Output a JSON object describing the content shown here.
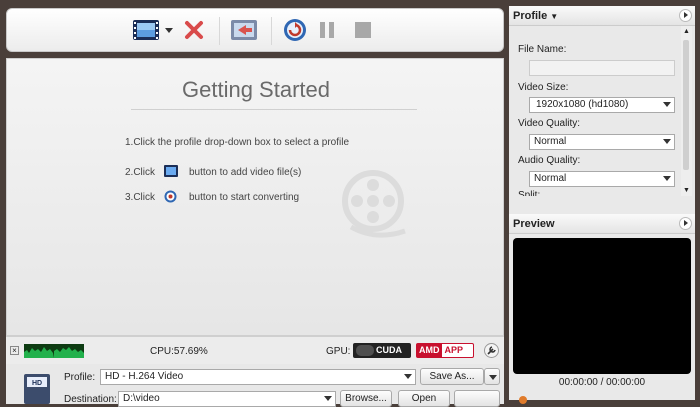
{
  "toolbar": {
    "buttons": [
      {
        "name": "add-video-button",
        "icon": "film-strip-icon"
      },
      {
        "name": "add-dropdown-button",
        "icon": "chevron-down-icon"
      },
      {
        "name": "remove-button",
        "icon": "red-x-icon"
      },
      {
        "name": "clip-button",
        "icon": "clip-icon"
      },
      {
        "name": "convert-button",
        "icon": "convert-icon"
      },
      {
        "name": "pause-button",
        "icon": "pause-icon"
      },
      {
        "name": "stop-button",
        "icon": "stop-icon"
      }
    ]
  },
  "main": {
    "title": "Getting Started",
    "step1": "1.Click the profile drop-down box to select a profile",
    "step2_prefix": "2.Click",
    "step2_suffix": "button to add video file(s)",
    "step3_prefix": "3.Click",
    "step3_suffix": "button to start converting"
  },
  "status": {
    "cpu": "CPU:57.69%",
    "gpu_label": "GPU:",
    "cuda": "CUDA",
    "amd": "AMD",
    "app": "APP"
  },
  "bottom": {
    "profile_label": "Profile:",
    "profile_value": "HD - H.264 Video",
    "save_as": "Save As...",
    "destination_label": "Destination:",
    "destination_value": "D:\\video",
    "browse": "Browse...",
    "open": "Open"
  },
  "right": {
    "profile_header": "Profile",
    "file_name_label": "File Name:",
    "file_name_value": "",
    "video_size_label": "Video Size:",
    "video_size_value": "1920x1080 (hd1080)",
    "video_quality_label": "Video Quality:",
    "video_quality_value": "Normal",
    "audio_quality_label": "Audio Quality:",
    "audio_quality_value": "Normal",
    "split_label": "Split:",
    "preview_header": "Preview",
    "time": "00:00:00 / 00:00:00"
  },
  "colors": {
    "accent_blue": "#2f67b3",
    "red_x": "#d94b4b",
    "amd_red": "#c8102e",
    "meter_green": "#22b14c"
  }
}
